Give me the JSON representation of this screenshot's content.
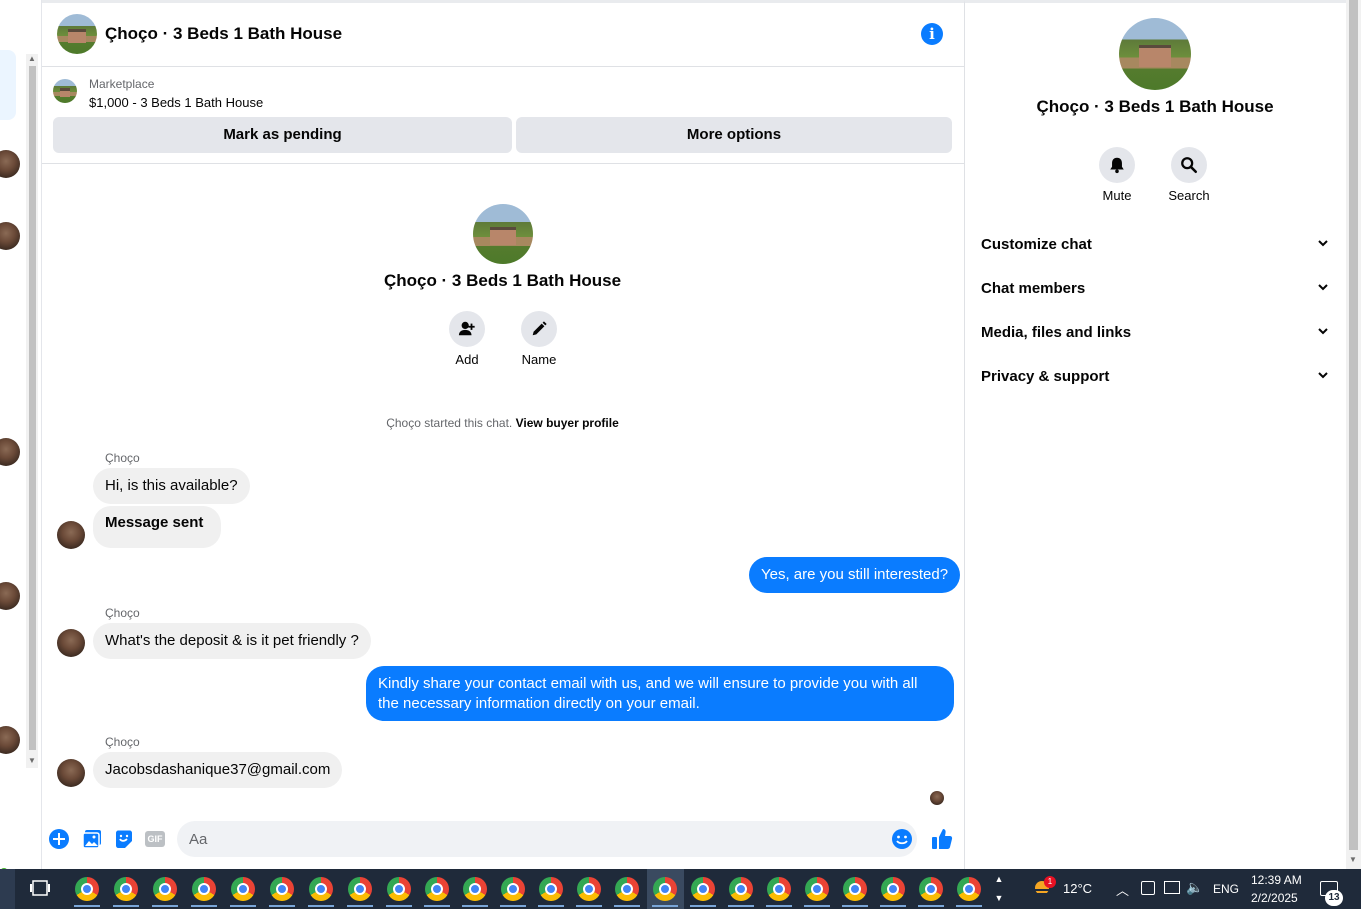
{
  "chat": {
    "title": "Çhoço · 3 Beds 1 Bath House",
    "info_icon": "info-icon",
    "marketplace": {
      "label": "Marketplace",
      "listing": "$1,000 - 3 Beds 1 Bath House",
      "mark_pending": "Mark as pending",
      "more_options": "More options"
    },
    "intro": {
      "title": "Çhoço · 3 Beds 1 Bath House",
      "add_label": "Add",
      "name_label": "Name",
      "started_text": "Çhoço started this chat.",
      "view_profile": "View buyer profile"
    },
    "messages": [
      {
        "sender": "Çhoço",
        "text": "Hi, is this available?",
        "direction": "in"
      },
      {
        "text": "Message sent",
        "direction": "in"
      },
      {
        "text": "Yes, are you still interested?",
        "direction": "out"
      },
      {
        "sender": "Çhoço",
        "text": "What's the deposit & is it pet friendly ?",
        "direction": "in"
      },
      {
        "text_line1": "Kindly share your contact email with us, and we will ensure to provide you with all",
        "text_line2": "the necessary information directly on your email.",
        "direction": "out"
      },
      {
        "sender": "Çhoço",
        "text": "Jacobsdashanique37@gmail.com",
        "direction": "in"
      }
    ],
    "composer": {
      "placeholder": "Aa",
      "gif_label": "GIF"
    }
  },
  "sidebar": {
    "title": "Çhoço · 3 Beds 1 Bath House",
    "mute_label": "Mute",
    "search_label": "Search",
    "sections": [
      {
        "label": "Customize chat"
      },
      {
        "label": "Chat members"
      },
      {
        "label": "Media, files and links"
      },
      {
        "label": "Privacy & support"
      }
    ]
  },
  "taskbar": {
    "weather_badge": "1",
    "temperature": "12°C",
    "language": "ENG",
    "time": "12:39 AM",
    "date": "2/2/2025",
    "notification_count": "13"
  },
  "colors": {
    "accent": "#0a7cff",
    "incoming_bubble": "#f0f0f0",
    "button_bg": "#e4e6eb",
    "taskbar": "#1f2a3a"
  }
}
